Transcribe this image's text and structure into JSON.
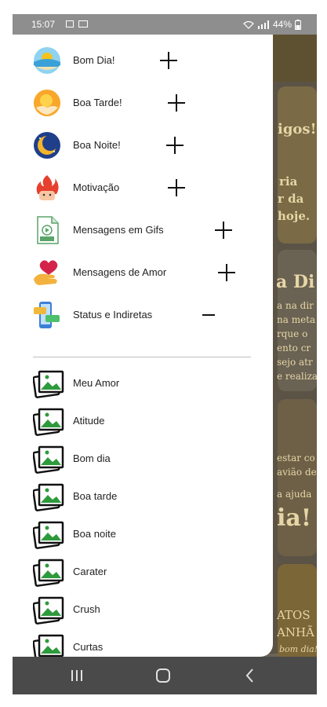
{
  "status_bar": {
    "time": "15:07",
    "battery": "44%",
    "icons": [
      "gallery-icon",
      "message-icon",
      "wifi-icon",
      "signal-icon",
      "battery-icon"
    ]
  },
  "drawer": {
    "categories": [
      {
        "label": "Bom Dia!",
        "icon": "sunrise-icon",
        "toggle": "+"
      },
      {
        "label": "Boa Tarde!",
        "icon": "sun-icon",
        "toggle": "+"
      },
      {
        "label": "Boa Noite!",
        "icon": "moon-icon",
        "toggle": "+"
      },
      {
        "label": "Motivação",
        "icon": "fire-icon",
        "toggle": "+"
      },
      {
        "label": "Mensagens em Gifs",
        "icon": "gif-file-icon",
        "toggle": "+"
      },
      {
        "label": "Mensagens de Amor",
        "icon": "heart-hand-icon",
        "toggle": "+"
      },
      {
        "label": "Status e Indiretas",
        "icon": "chat-phone-icon",
        "toggle": "−"
      }
    ],
    "subcategories": [
      {
        "label": "Meu Amor",
        "icon": "image-stack-icon"
      },
      {
        "label": "Atitude",
        "icon": "image-stack-icon"
      },
      {
        "label": "Bom dia",
        "icon": "image-stack-icon"
      },
      {
        "label": "Boa tarde",
        "icon": "image-stack-icon"
      },
      {
        "label": "Boa noite",
        "icon": "image-stack-icon"
      },
      {
        "label": "Carater",
        "icon": "image-stack-icon"
      },
      {
        "label": "Crush",
        "icon": "image-stack-icon"
      },
      {
        "label": "Curtas",
        "icon": "image-stack-icon"
      }
    ]
  },
  "background": {
    "texts": [
      "igos!",
      "ria",
      "r da",
      "hoje.",
      "a Di",
      "a na dir",
      "na meta",
      "rque o",
      "ento cr",
      "sejo atr",
      "e realiza",
      "estar co",
      "avião de",
      "a ajuda",
      "ia!",
      "ATOS",
      "ANHÃ",
      "bom dia!"
    ]
  },
  "nav_bar": {
    "icons": [
      "recents-icon",
      "home-icon",
      "back-icon"
    ]
  },
  "colors": {
    "status_bar": "#8e8e8e",
    "nav_bar": "#4a4a4a",
    "background_card": "#b8892a",
    "drawer": "#ffffff",
    "image_icon_green": "#2e9a3c"
  }
}
